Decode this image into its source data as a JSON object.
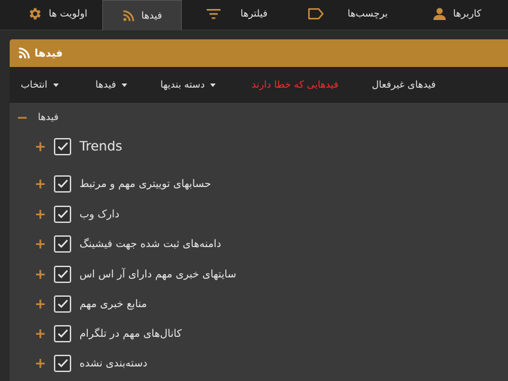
{
  "top_tabs": [
    {
      "label": "اولویت ها",
      "icon": "gear-icon"
    },
    {
      "label": "فیدها",
      "icon": "rss-icon",
      "active": true
    },
    {
      "label": "فیلترها",
      "icon": "filter-icon"
    },
    {
      "label": "برچسب‌ها",
      "icon": "tag-icon"
    },
    {
      "label": "کاربرها",
      "icon": "user-icon"
    }
  ],
  "panel": {
    "title": "فیدها",
    "icon": "rss-icon"
  },
  "toolbar": {
    "select_label": "انتخاب",
    "feeds_label": "فیدها",
    "categories_label": "دسته بندیها",
    "error_feeds_label": "فیدهایی که خطا دارند",
    "inactive_feeds_label": "فیدهای غیرفعال"
  },
  "tree": {
    "root_label": "فیدها",
    "items": [
      {
        "label": "Trends",
        "checked": true
      },
      {
        "label": "حسابهای توییتری مهم و مرتبط",
        "checked": true
      },
      {
        "label": "دارک وب",
        "checked": true
      },
      {
        "label": "دامنه‌های ثبت شده جهت فیشینگ",
        "checked": true
      },
      {
        "label": "سایتهای خبری مهم دارای آر اس اس",
        "checked": true
      },
      {
        "label": "منابع خبری مهم",
        "checked": true
      },
      {
        "label": "کانال‌های مهم در تلگرام",
        "checked": true
      },
      {
        "label": "دسته‌بندی نشده",
        "checked": true
      }
    ]
  },
  "colors": {
    "accent": "#b8832f",
    "error": "#ff2a2a",
    "background": "#2b2b2b"
  }
}
